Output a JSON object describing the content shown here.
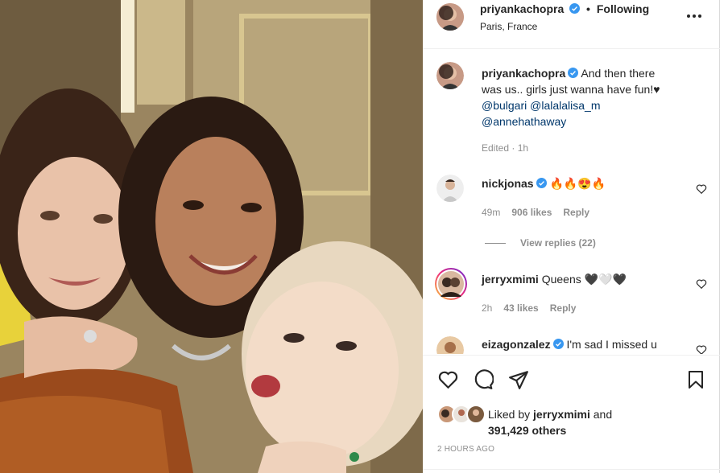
{
  "header": {
    "username": "priyankachopra",
    "separator": "•",
    "follow_status": "Following",
    "location": "Paris, France",
    "more_icon": "more-horizontal-icon"
  },
  "caption": {
    "username": "priyankachopra",
    "text_line1_rest": "And then there",
    "text_line2": "was us.. girls just wanna have fun!♥",
    "mention1": "@bulgari",
    "mention2": "@lalalalisa_m",
    "mention3": "@annehathaway",
    "edited": "Edited",
    "dot": "·",
    "time": "1h"
  },
  "comments": [
    {
      "username": "nickjonas",
      "text": "🔥🔥😍🔥",
      "age": "49m",
      "likes": "906 likes",
      "reply": "Reply",
      "view_replies": "View replies (22)"
    },
    {
      "username": "jerryxmimi",
      "text": "Queens 🖤🤍🖤",
      "age": "2h",
      "likes": "43 likes",
      "reply": "Reply"
    },
    {
      "username": "eizagonzalez",
      "text": "I'm sad I missed u"
    }
  ],
  "footer": {
    "liked_by_prefix": "Liked by",
    "liked_by_user": "jerryxmimi",
    "liked_by_and": "and",
    "liked_by_count": "391,429 others",
    "timestamp": "2 HOURS AGO"
  },
  "colors": {
    "verified_blue": "#3897f0",
    "link": "#00376b",
    "muted": "#8e8e8e",
    "text": "#262626"
  }
}
